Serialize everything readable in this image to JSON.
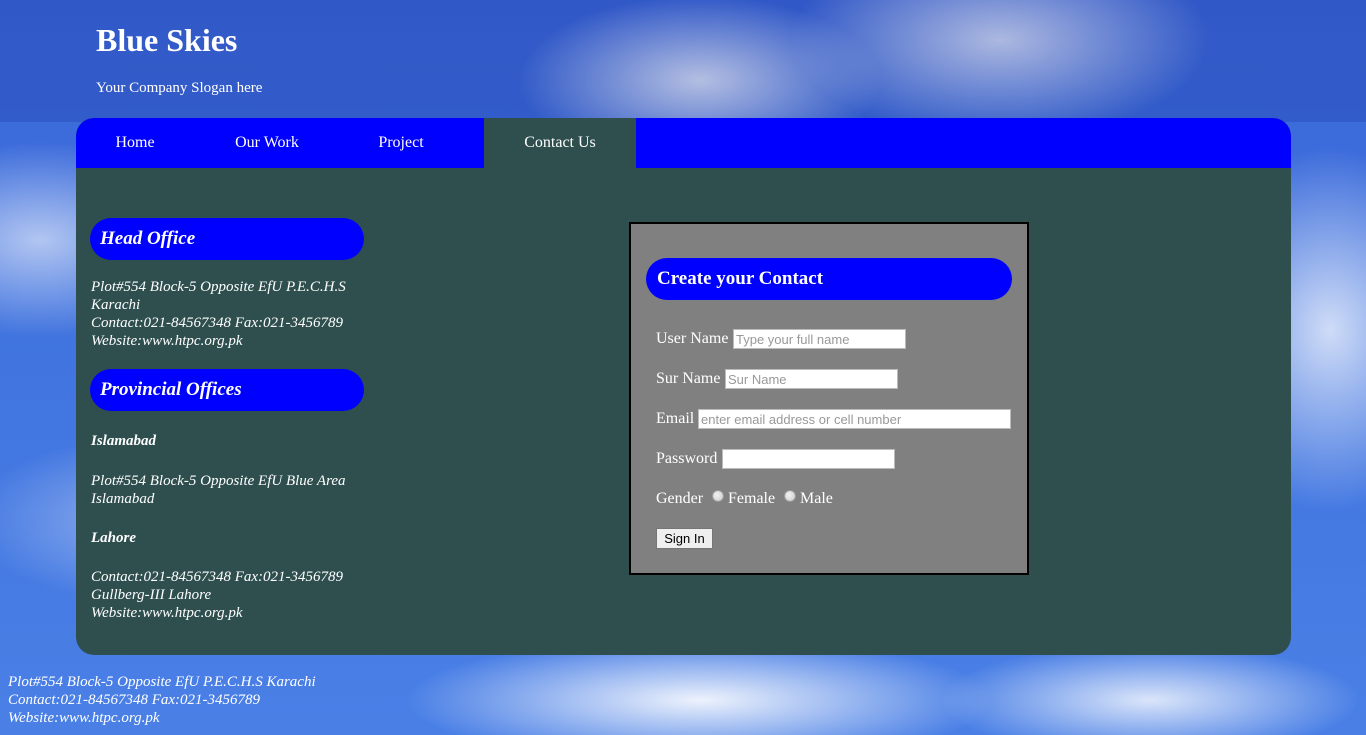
{
  "header": {
    "title": "Blue Skies",
    "slogan": "Your Company Slogan here"
  },
  "nav": {
    "items": [
      "Home",
      "Our Work",
      "Project",
      "Contact Us"
    ],
    "active": "Contact Us"
  },
  "sidebar": {
    "head_office": {
      "heading": "Head Office",
      "address_line1": "Plot#554 Block-5 Opposite EfU P.E.C.H.S",
      "address_line2": "Karachi",
      "contact": "Contact:021-84567348 Fax:021-3456789",
      "website": "Website:www.htpc.org.pk"
    },
    "provincial": {
      "heading": "Provincial Offices",
      "islamabad": {
        "city": "Islamabad",
        "address_line1": "Plot#554 Block-5 Opposite EfU Blue Area",
        "address_line2": "Islamabad"
      },
      "lahore": {
        "city": "Lahore",
        "contact": "Contact:021-84567348 Fax:021-3456789",
        "address": "Gullberg-III Lahore",
        "website": "Website:www.htpc.org.pk"
      }
    }
  },
  "form": {
    "heading": "Create your Contact",
    "username_label": "User Name",
    "username_placeholder": "Type your full name",
    "surname_label": "Sur Name",
    "surname_placeholder": "Sur Name",
    "email_label": "Email",
    "email_placeholder": "enter email address or cell number",
    "password_label": "Password",
    "gender_label": "Gender",
    "gender_female": "Female",
    "gender_male": "Male",
    "submit_label": "Sign In"
  },
  "footer": {
    "address": "Plot#554 Block-5 Opposite EfU P.E.C.H.S Karachi",
    "contact": "Contact:021-84567348 Fax:021-3456789",
    "website": "Website:www.htpc.org.pk"
  },
  "colors": {
    "nav_blue": "#0000ff",
    "panel": "#2f4f4f",
    "form_bg": "#808080"
  }
}
